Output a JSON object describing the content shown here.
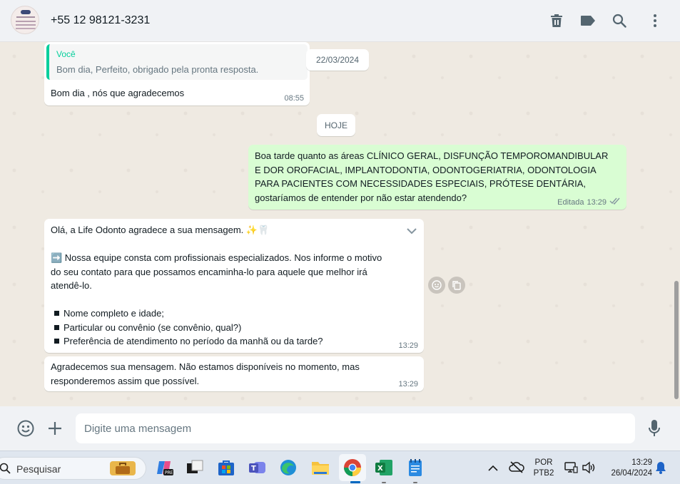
{
  "header": {
    "contact_name": "+55 12 98121-3231",
    "icons": [
      "trash-icon",
      "label-tag-icon",
      "search-icon",
      "more-vertical-icon"
    ]
  },
  "messages": {
    "m1": {
      "quote_author": "Você",
      "quote_text": "Bom dia, Perfeito, obrigado pela pronta resposta.",
      "text": "Bom dia , nós que agradecemos",
      "time": "08:55"
    },
    "date1": "22/03/2024",
    "date2": "HOJE",
    "m2": {
      "lines": [
        "Boa tarde quanto as áreas CLÍNICO GERAL, DISFUNÇÃO TEMPOROMANDIBULAR",
        "E DOR OROFACIAL, IMPLANTODONTIA, ODONTOGERIATRIA, ODONTOLOGIA",
        "PARA PACIENTES COM NECESSIDADES ESPECIAIS,  PRÓTESE DENTÁRIA,",
        "gostaríamos de entender por não estar atendendo?"
      ],
      "edited": "Editada",
      "time": "13:29"
    },
    "m3": {
      "line1": "Olá, a Life Odonto agradece a sua mensagem. ✨🦷",
      "para_lines": [
        "➡️ Nossa equipe consta com profissionais especializados. Nos informe o motivo",
        "do seu contato para que possamos encaminha-lo para aquele que melhor irá",
        "atendê-lo."
      ],
      "bullets": [
        "Nome completo e idade;",
        "Particular ou convênio (se convênio, qual?)",
        "Preferência de atendimento no período da manhã ou da tarde?"
      ],
      "time": "13:29"
    },
    "m4": {
      "lines": [
        "Agradecemos sua mensagem. Não estamos disponíveis no momento, mas",
        "responderemos assim que possível."
      ],
      "time": "13:29"
    }
  },
  "composer": {
    "placeholder": "Digite uma mensagem"
  },
  "taskbar": {
    "search_label": "Pesquisar",
    "lang_line1": "POR",
    "lang_line2": "PTB2",
    "clock_time": "13:29",
    "clock_date": "26/04/2024"
  },
  "colors": {
    "accent_green": "#06cf9c",
    "outgoing_bubble": "#d9fdd3",
    "chat_bg": "#efeae2"
  }
}
